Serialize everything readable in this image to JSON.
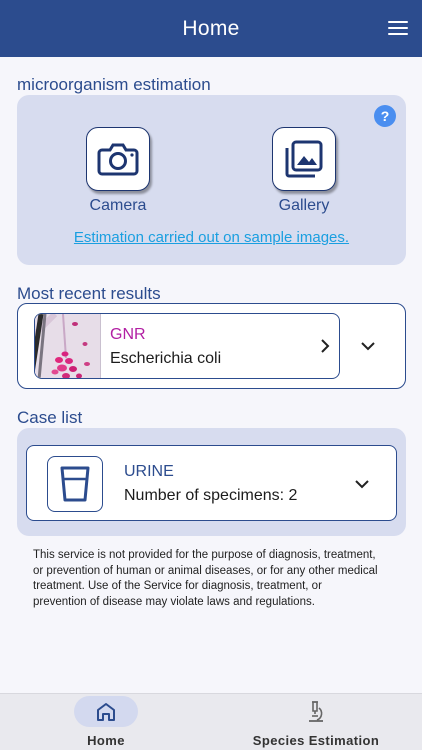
{
  "header": {
    "title": "Home",
    "menu_icon": "hamburger-menu-icon"
  },
  "estimation": {
    "section_title": "microorganism estimation",
    "help_label": "?",
    "camera_label": "Camera",
    "gallery_label": "Gallery",
    "sample_link": "Estimation carried out on sample images."
  },
  "recent": {
    "section_title": "Most recent results",
    "gram": "GNR",
    "species": "Escherichia coli"
  },
  "cases": {
    "section_title": "Case list",
    "type": "URINE",
    "count_text": "Number of specimens: 2"
  },
  "disclaimer": "This service is not provided for the purpose of diagnosis, treatment, or prevention of human or animal diseases, or for any other medical treatment. Use of the Service for diagnosis, treatment, or prevention of disease may violate laws and regulations.",
  "bottom_nav": {
    "home_label": "Home",
    "species_label": "Species Estimation",
    "active": "Home"
  },
  "colors": {
    "primary": "#2c4c8e",
    "card_bg": "#d7dcef",
    "link": "#1a9fe0",
    "gram_label": "#b21fa3",
    "help": "#4a8ef0"
  }
}
